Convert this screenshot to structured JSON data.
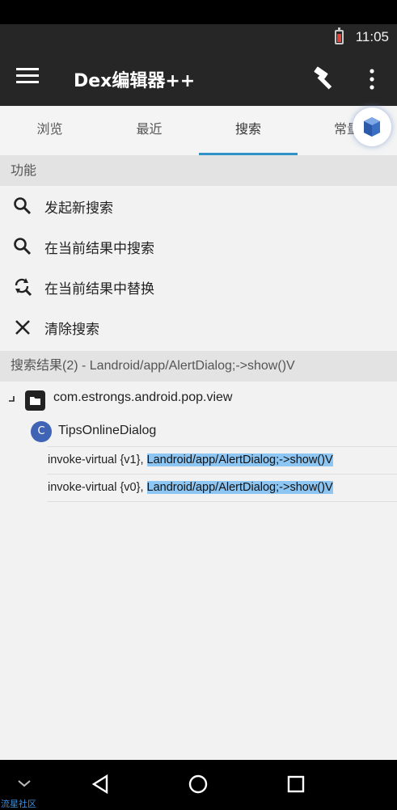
{
  "status_bar": {
    "time": "11:05",
    "battery_icon": "battery-low-icon"
  },
  "toolbar": {
    "title": "Dex编辑器++",
    "menu_icon": "hamburger-menu-icon",
    "build_icon": "hammer-icon",
    "more_icon": "more-vert-icon"
  },
  "tabs": [
    {
      "label": "浏览",
      "active": false
    },
    {
      "label": "最近",
      "active": false
    },
    {
      "label": "搜索",
      "active": true
    },
    {
      "label": "常量",
      "active": false
    }
  ],
  "floating_button": {
    "icon": "cube-icon"
  },
  "functions": {
    "header": "功能",
    "items": [
      {
        "label": "发起新搜索",
        "icon": "search-icon"
      },
      {
        "label": "在当前结果中搜索",
        "icon": "search-icon"
      },
      {
        "label": "在当前结果中替换",
        "icon": "find-replace-icon"
      },
      {
        "label": "清除搜索",
        "icon": "close-icon"
      }
    ]
  },
  "results": {
    "header": "搜索结果(2) - Landroid/app/AlertDialog;->show()V",
    "package": "com.estrongs.android.pop.view",
    "class_badge": "C",
    "class_name": "TipsOnlineDialog",
    "matches": [
      {
        "prefix": "invoke-virtual {v1}, ",
        "highlight": "Landroid/app/AlertDialog;->show()V"
      },
      {
        "prefix": "invoke-virtual {v0}, ",
        "highlight": "Landroid/app/AlertDialog;->show()V"
      }
    ]
  },
  "nav_bar": {
    "collapse_icon": "chevron-down-icon",
    "back_icon": "back-triangle-icon",
    "home_icon": "home-circle-icon",
    "recents_icon": "recents-square-icon"
  },
  "watermark": "流星社区",
  "colors": {
    "toolbar_bg": "#262626",
    "tab_indicator": "#2f92c8",
    "highlight": "#8ec6f3",
    "class_badge": "#3f63b5"
  }
}
